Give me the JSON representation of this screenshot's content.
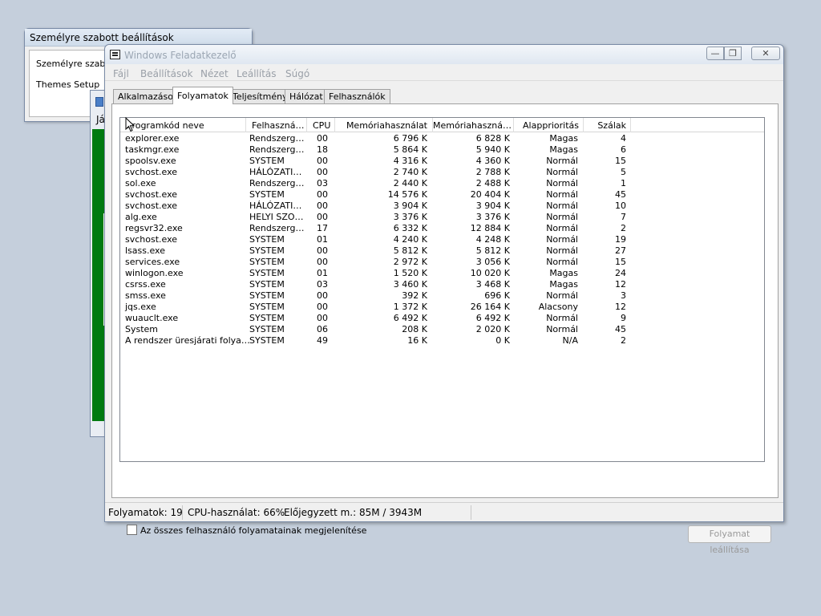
{
  "back_window_1": {
    "title": "Személyre szabott beállítások",
    "items": [
      "Személyre szabott",
      "Themes Setup"
    ]
  },
  "back_window_2": {
    "label": "Já"
  },
  "task_manager": {
    "title": "Windows Feladatkezelő",
    "menu": [
      "Fájl",
      "Beállítások",
      "Nézet",
      "Leállítás",
      "Súgó"
    ],
    "tabs": [
      "Alkalmazások",
      "Folyamatok",
      "Teljesítmény",
      "Hálózat",
      "Felhasználók"
    ],
    "active_tab": "Folyamatok",
    "columns": [
      "Programkód neve",
      "Felhaszná…",
      "CPU",
      "Memóriahasználat",
      "Memóriahaszná…",
      "Alapprioritás",
      "Szálak"
    ],
    "rows": [
      [
        "explorer.exe",
        "Rendszerg…",
        "00",
        "6 796 K",
        "6 828 K",
        "Magas",
        "4"
      ],
      [
        "taskmgr.exe",
        "Rendszerg…",
        "18",
        "5 864 K",
        "5 940 K",
        "Magas",
        "6"
      ],
      [
        "spoolsv.exe",
        "SYSTEM",
        "00",
        "4 316 K",
        "4 360 K",
        "Normál",
        "15"
      ],
      [
        "svchost.exe",
        "HÁLÓZATI…",
        "00",
        "2 740 K",
        "2 788 K",
        "Normál",
        "5"
      ],
      [
        "sol.exe",
        "Rendszerg…",
        "03",
        "2 440 K",
        "2 488 K",
        "Normál",
        "1"
      ],
      [
        "svchost.exe",
        "SYSTEM",
        "00",
        "14 576 K",
        "20 404 K",
        "Normál",
        "45"
      ],
      [
        "svchost.exe",
        "HÁLÓZATI…",
        "00",
        "3 904 K",
        "3 904 K",
        "Normál",
        "10"
      ],
      [
        "alg.exe",
        "HELYI SZO…",
        "00",
        "3 376 K",
        "3 376 K",
        "Normál",
        "7"
      ],
      [
        "regsvr32.exe",
        "Rendszerg…",
        "17",
        "6 332 K",
        "12 884 K",
        "Normál",
        "2"
      ],
      [
        "svchost.exe",
        "SYSTEM",
        "01",
        "4 240 K",
        "4 248 K",
        "Normál",
        "19"
      ],
      [
        "lsass.exe",
        "SYSTEM",
        "00",
        "5 812 K",
        "5 812 K",
        "Normál",
        "27"
      ],
      [
        "services.exe",
        "SYSTEM",
        "00",
        "2 972 K",
        "3 056 K",
        "Normál",
        "15"
      ],
      [
        "winlogon.exe",
        "SYSTEM",
        "01",
        "1 520 K",
        "10 020 K",
        "Magas",
        "24"
      ],
      [
        "csrss.exe",
        "SYSTEM",
        "03",
        "3 460 K",
        "3 468 K",
        "Magas",
        "12"
      ],
      [
        "smss.exe",
        "SYSTEM",
        "00",
        "392 K",
        "696 K",
        "Normál",
        "3"
      ],
      [
        "jqs.exe",
        "SYSTEM",
        "00",
        "1 372 K",
        "26 164 K",
        "Alacsony",
        "12"
      ],
      [
        "wuauclt.exe",
        "SYSTEM",
        "00",
        "6 492 K",
        "6 492 K",
        "Normál",
        "9"
      ],
      [
        "System",
        "SYSTEM",
        "06",
        "208 K",
        "2 020 K",
        "Normál",
        "45"
      ],
      [
        "A rendszer üresjárati folya…",
        "SYSTEM",
        "49",
        "16 K",
        "0 K",
        "N/A",
        "2"
      ]
    ],
    "show_all_label": "Az összes felhasználó folyamatainak megjelenítése",
    "show_all_checked": false,
    "end_process_label": "Folyamat leállítása",
    "status": {
      "processes": "Folyamatok: 19",
      "cpu": "CPU-használat: 66%",
      "commit": "Előjegyzett m.: 85M / 3943M"
    }
  }
}
